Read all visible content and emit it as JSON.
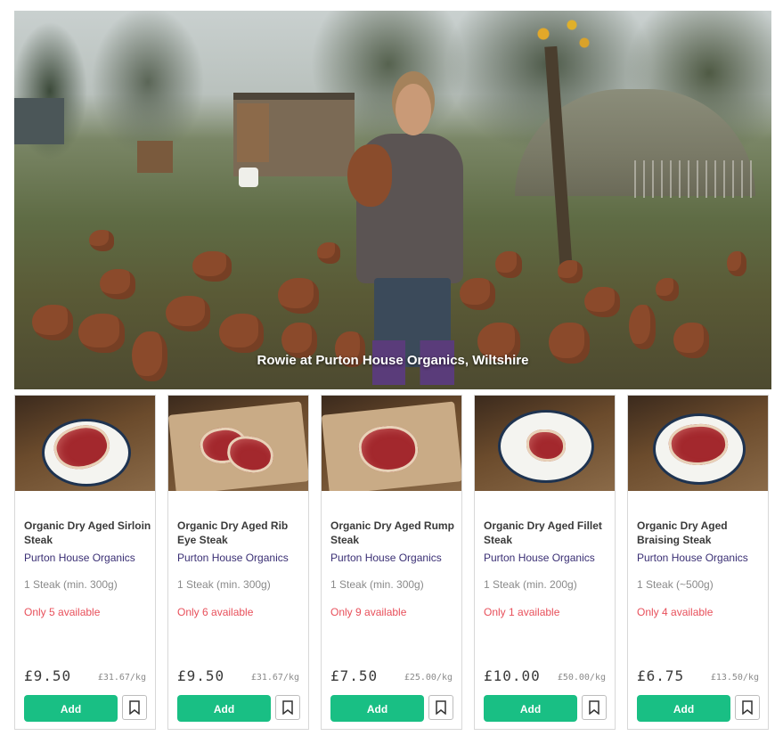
{
  "hero": {
    "caption": "Rowie at Purton House Organics, Wiltshire"
  },
  "products": [
    {
      "name": "Organic Dry Aged Sirloin Steak",
      "producer": "Purton House Organics",
      "size": "1 Steak (min. 300g)",
      "availability": "Only 5 available",
      "price": "£9.50",
      "unit_price": "£31.67/kg",
      "add_label": "Add",
      "image_icon": "sirloin-steak-photo"
    },
    {
      "name": "Organic Dry Aged Rib Eye Steak",
      "producer": "Purton House Organics",
      "size": "1 Steak (min. 300g)",
      "availability": "Only 6 available",
      "price": "£9.50",
      "unit_price": "£31.67/kg",
      "add_label": "Add",
      "image_icon": "rib-eye-steak-photo"
    },
    {
      "name": "Organic Dry Aged Rump Steak",
      "producer": "Purton House Organics",
      "size": "1 Steak (min. 300g)",
      "availability": "Only 9 available",
      "price": "£7.50",
      "unit_price": "£25.00/kg",
      "add_label": "Add",
      "image_icon": "rump-steak-photo"
    },
    {
      "name": "Organic Dry Aged Fillet Steak",
      "producer": "Purton House Organics",
      "size": "1 Steak (min. 200g)",
      "availability": "Only 1 available",
      "price": "£10.00",
      "unit_price": "£50.00/kg",
      "add_label": "Add",
      "image_icon": "fillet-steak-photo"
    },
    {
      "name": "Organic Dry Aged Braising Steak",
      "producer": "Purton House Organics",
      "size": "1 Steak (~500g)",
      "availability": "Only 4 available",
      "price": "£6.75",
      "unit_price": "£13.50/kg",
      "add_label": "Add",
      "image_icon": "braising-steak-photo"
    }
  ],
  "colors": {
    "add_button": "#19bf84",
    "producer_text": "#3a2f74",
    "availability_text": "#e8505b"
  }
}
